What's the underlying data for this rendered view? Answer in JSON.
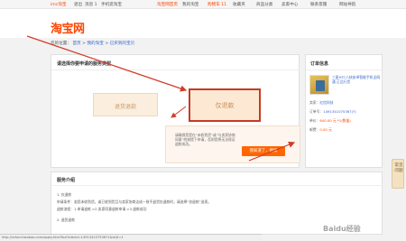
{
  "topbar": {
    "items": [
      "imc淘宝",
      "退出",
      "消息 1",
      "手机逛淘宝",
      "淘宝网首页",
      "我的淘宝",
      "购物车 11",
      "收藏夹",
      "商品分类",
      "卖家中心",
      "联系客服",
      "网站导航"
    ]
  },
  "header": {
    "logo": "淘宝网"
  },
  "breadcrumb": {
    "prefix": "您的位置：",
    "items": [
      "首页",
      "我的淘宝",
      "已买到的宝贝"
    ],
    "sep": ">"
  },
  "main": {
    "title": "请选择你要申请的服务类型",
    "option_refund": "退货退款",
    "option_return": "仅退款",
    "tip_text": "请确保您是在“未收到货”或“与卖家协商同意”的前提下申请，否则您将无法保证退款成功。",
    "tip_button": "我知道了，继续"
  },
  "side": {
    "title": "订单信息",
    "product_title": "三星HTC八核安卓智能手机全网通 正品行货",
    "rows": [
      {
        "label": "卖家：",
        "value": "红信科技"
      },
      {
        "label": "订单号：",
        "value": "1491341075367(?)"
      },
      {
        "label": "单价：",
        "value": "640.00 元 *1(数量)"
      },
      {
        "label": "邮费：",
        "value": "0.00 元"
      }
    ]
  },
  "help": {
    "label": "常见问题"
  },
  "intro": {
    "title": "服务介绍",
    "lines": [
      "1. 仅退款",
      "申请条件：若您未收到货，或已收到货且与卖家协商达成一致不退货仅退款时，请选择“仅退款”选项。",
      "退款流程：1.申请退款 >2.卖家同意退款申请 >3.退款成功",
      "2. 退货退款"
    ]
  },
  "status": {
    "text": "http://refund.taobao.com/apply.htm?bizOrderId=14913410753671&isQt=1"
  },
  "watermark": {
    "text": "Baidu经验"
  },
  "colors": {
    "accent": "#ff4400",
    "highlight": "#c73a25",
    "button": "#ff6600"
  }
}
